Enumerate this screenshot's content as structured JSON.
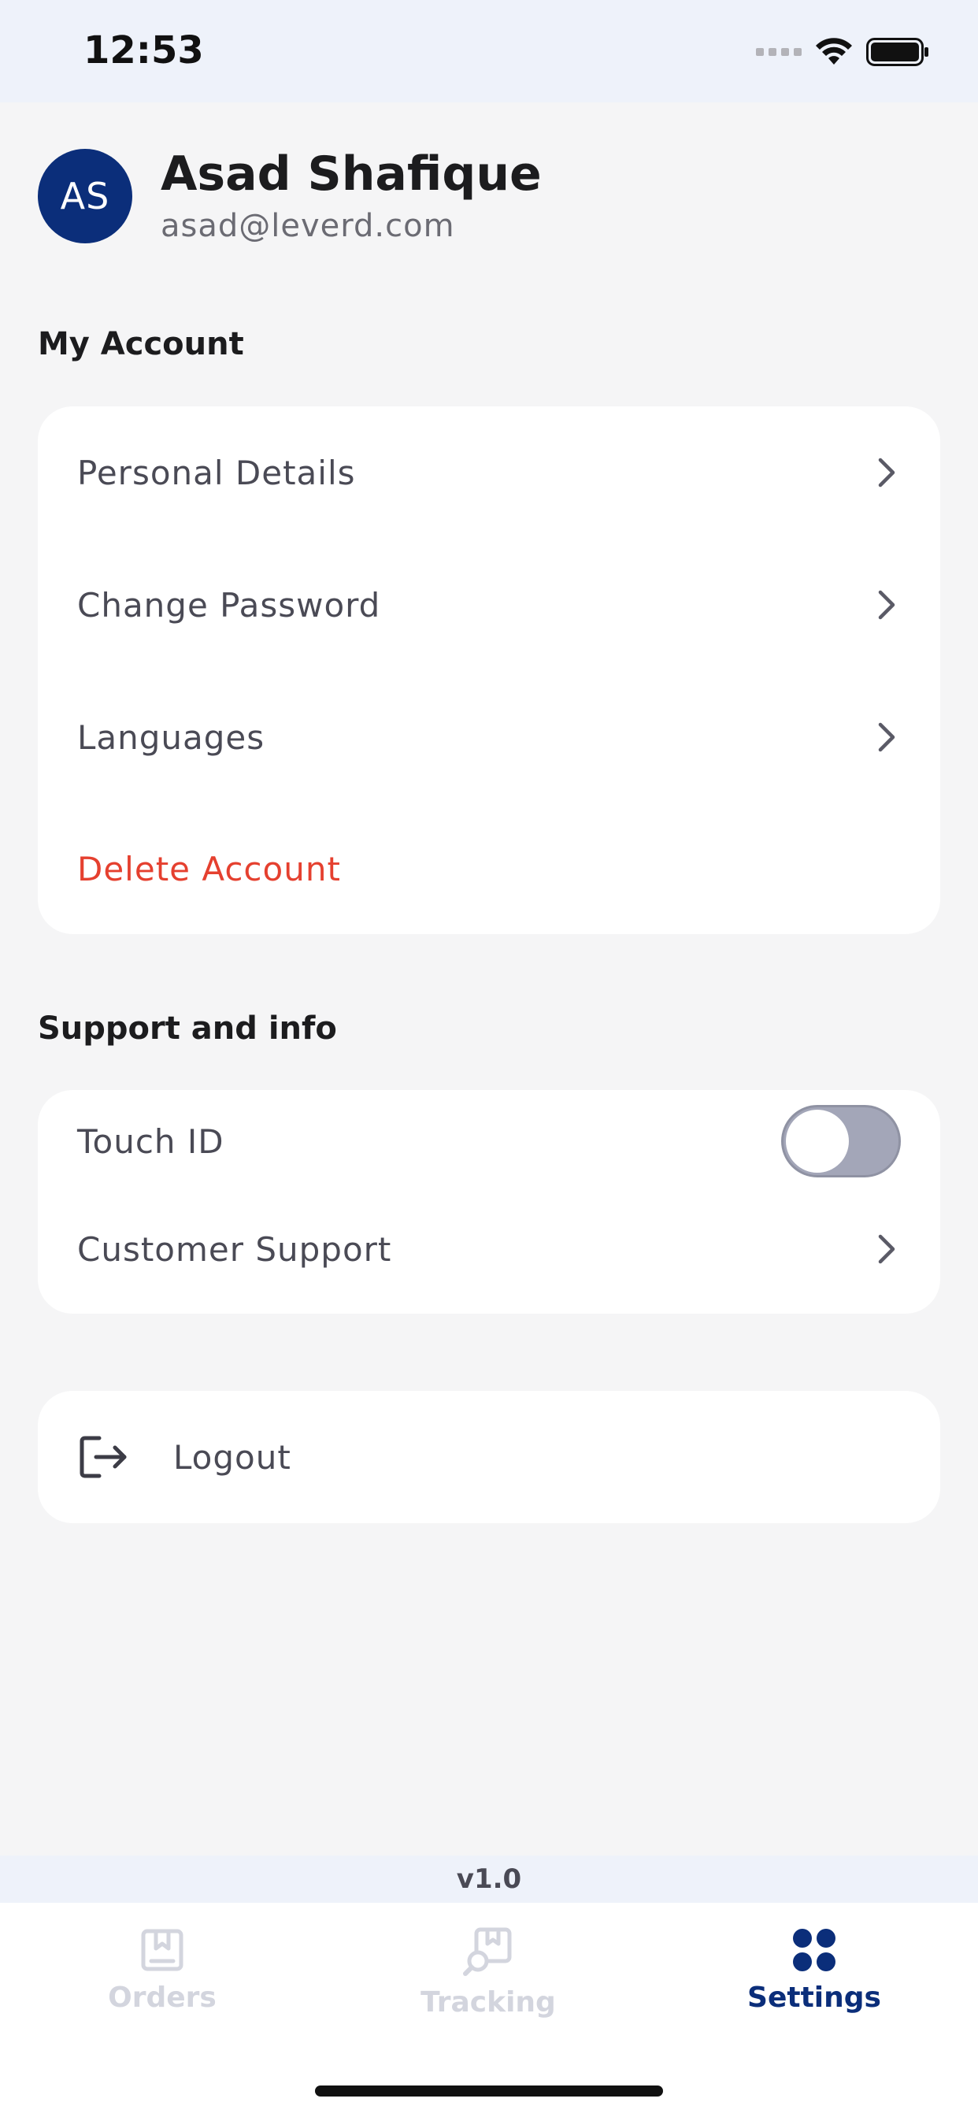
{
  "status_bar": {
    "time": "12:53"
  },
  "profile": {
    "initials": "AS",
    "name": "Asad Shafique",
    "email": "asad@leverd.com",
    "avatar_color": "#0b2e7a"
  },
  "my_account": {
    "title": "My Account",
    "items": [
      {
        "label": "Personal Details",
        "icon": "chevron-right-icon"
      },
      {
        "label": "Change Password",
        "icon": "chevron-right-icon"
      },
      {
        "label": "Languages",
        "icon": "chevron-right-icon"
      },
      {
        "label": "Delete Account",
        "color": "#e5402f"
      }
    ]
  },
  "support": {
    "title": "Support and info",
    "touch_id": {
      "label": "Touch ID",
      "enabled": false
    },
    "customer_support": {
      "label": "Customer Support",
      "icon": "chevron-right-icon"
    }
  },
  "logout": {
    "label": "Logout",
    "icon": "logout-icon"
  },
  "version": "v1.0",
  "tabs": [
    {
      "label": "Orders",
      "icon": "orders-icon",
      "active": false
    },
    {
      "label": "Tracking",
      "icon": "tracking-icon",
      "active": false
    },
    {
      "label": "Settings",
      "icon": "settings-icon",
      "active": true
    }
  ],
  "colors": {
    "accent": "#0b2e7a",
    "danger": "#e5402f",
    "inactive_tab": "#d3d5de"
  }
}
